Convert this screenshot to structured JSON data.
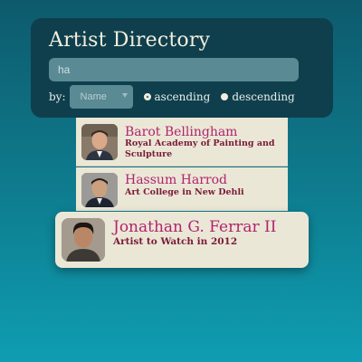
{
  "directory": {
    "title": "Artist Directory",
    "search": {
      "value": "ha",
      "placeholder": ""
    },
    "sort": {
      "by_label": "by:",
      "field_selected": "Name",
      "ascending_label": "ascending",
      "descending_label": "descending",
      "order_selected": "ascending"
    }
  },
  "results": [
    {
      "name": "Barot Bellingham",
      "subtitle": "Royal Academy of Painting and Sculpture"
    },
    {
      "name": "Hassum Harrod",
      "subtitle": "Art College in New Dehli"
    },
    {
      "name": "Jonathan G. Ferrar II",
      "subtitle": "Artist to Watch in 2012"
    }
  ],
  "colors": {
    "panel": "#0f3f4d",
    "card": "#ebe7d6",
    "name": "#b0246e",
    "subtitle": "#7a1a3a"
  }
}
